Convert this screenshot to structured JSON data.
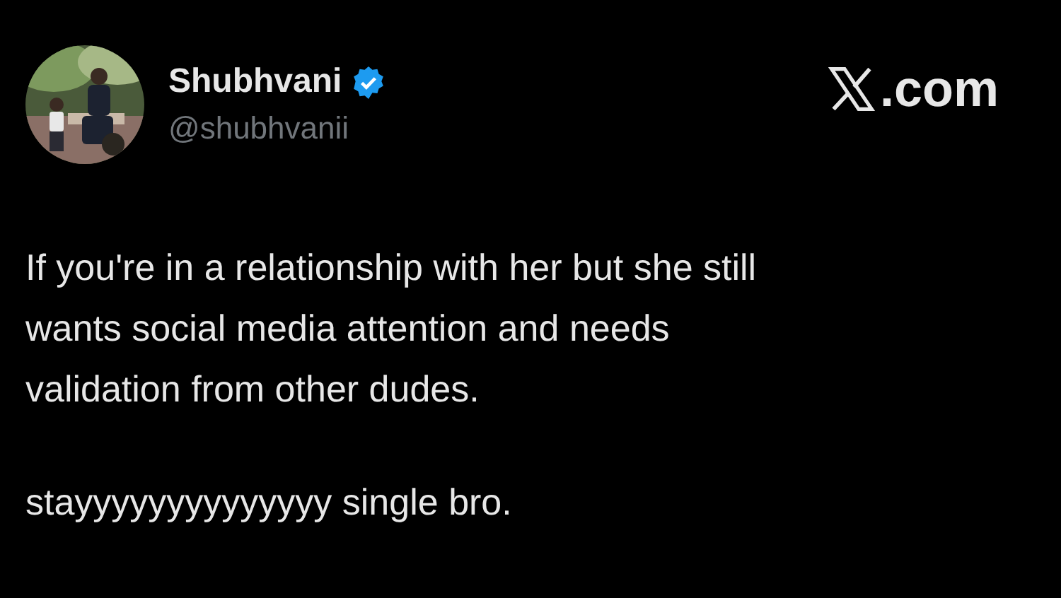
{
  "author": {
    "name": "Shubhvani",
    "verified": true,
    "handle": "@shubhvanii"
  },
  "brand": {
    "suffix": ".com"
  },
  "paragraphs": [
    "If you're in a relationship with her but she still\nwants social media attention and needs\nvalidation from other dudes.",
    "stayyyyyyyyyyyyyy single bro."
  ]
}
